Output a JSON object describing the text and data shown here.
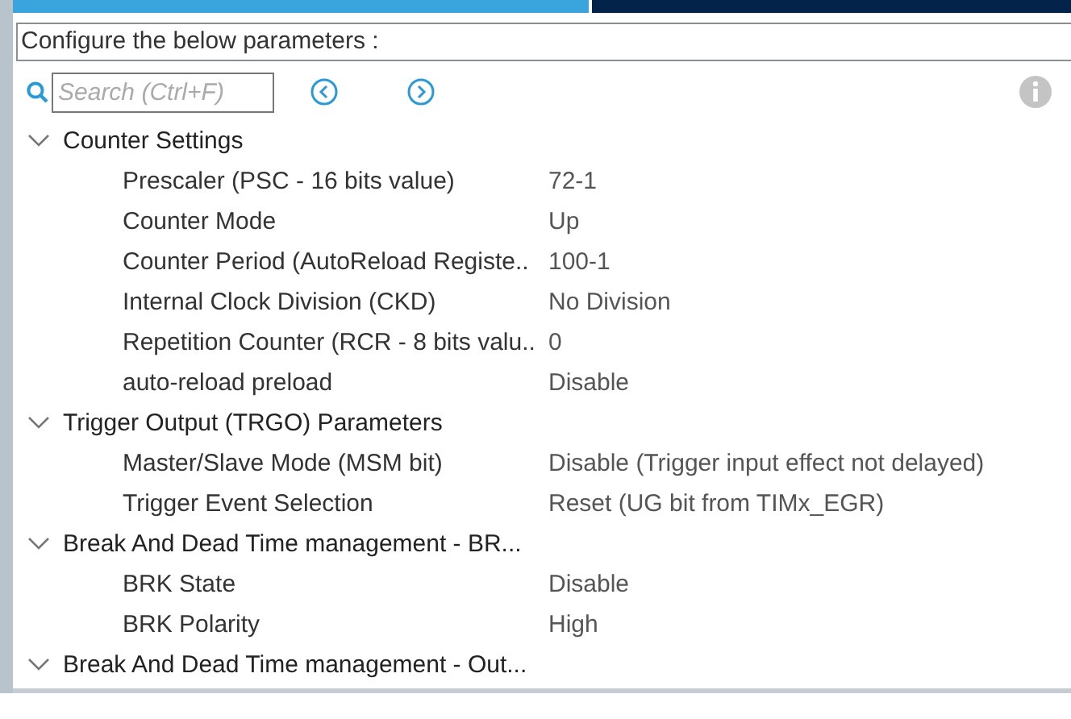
{
  "tabs": [
    {
      "selected": true
    },
    {
      "selected": false
    }
  ],
  "header": "Configure the below parameters :",
  "search": {
    "placeholder": "Search (Ctrl+F)"
  },
  "groups": [
    {
      "label": "Counter Settings",
      "expanded": true,
      "children": [
        {
          "label": "Prescaler (PSC - 16 bits value)",
          "value": "72-1"
        },
        {
          "label": "Counter Mode",
          "value": "Up"
        },
        {
          "label": "Counter Period (AutoReload Registe..",
          "value": "100-1"
        },
        {
          "label": "Internal Clock Division (CKD)",
          "value": "No Division"
        },
        {
          "label": "Repetition Counter (RCR - 8 bits valu..",
          "value": "0"
        },
        {
          "label": "auto-reload preload",
          "value": "Disable"
        }
      ]
    },
    {
      "label": "Trigger Output (TRGO) Parameters",
      "expanded": true,
      "children": [
        {
          "label": "Master/Slave Mode (MSM bit)",
          "value": "Disable (Trigger input effect not delayed)"
        },
        {
          "label": "Trigger Event Selection",
          "value": "Reset (UG bit from TIMx_EGR)"
        }
      ]
    },
    {
      "label": "Break And Dead Time management - BR...",
      "expanded": true,
      "children": [
        {
          "label": "BRK State",
          "value": "Disable"
        },
        {
          "label": "BRK Polarity",
          "value": "High"
        }
      ]
    },
    {
      "label": "Break And Dead Time management - Out...",
      "expanded": true
    }
  ]
}
